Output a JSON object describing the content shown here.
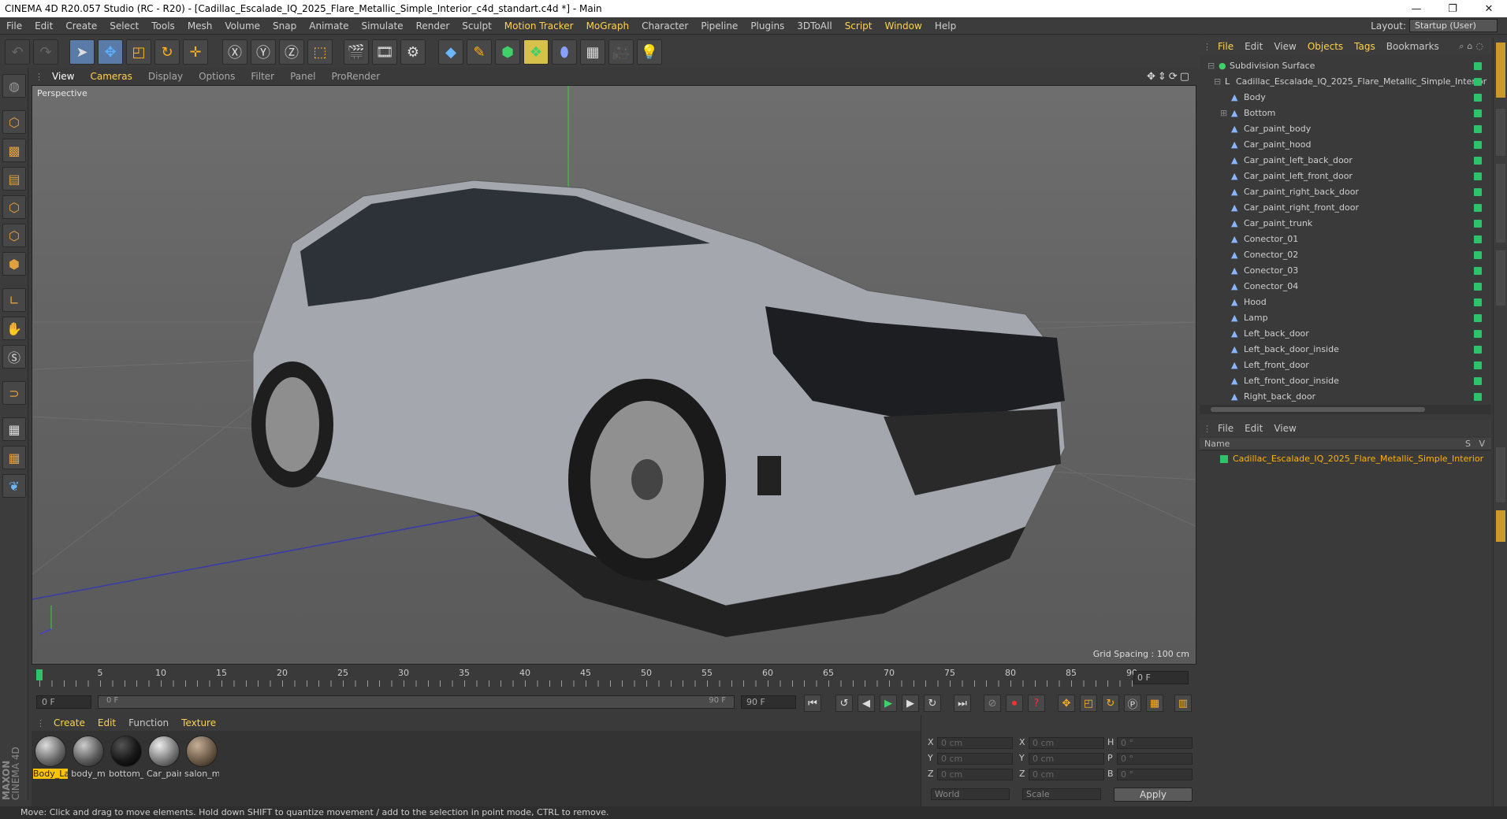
{
  "window": {
    "title": "CINEMA 4D R20.057 Studio (RC - R20) - [Cadillac_Escalade_IQ_2025_Flare_Metallic_Simple_Interior_c4d_standart.c4d *] - Main",
    "min": "—",
    "restore": "❐",
    "close": "✕"
  },
  "menu": [
    "File",
    "Edit",
    "Create",
    "Select",
    "Tools",
    "Mesh",
    "Volume",
    "Snap",
    "Animate",
    "Simulate",
    "Render",
    "Sculpt",
    "Motion Tracker",
    "MoGraph",
    "Character",
    "Pipeline",
    "Plugins",
    "3DToAll",
    "Script",
    "Window",
    "Help"
  ],
  "layout": {
    "label": "Layout:",
    "value": "Startup (User)"
  },
  "viewport": {
    "menu": [
      "View",
      "Cameras",
      "Display",
      "Options",
      "Filter",
      "Panel",
      "ProRender"
    ],
    "label": "Perspective",
    "grid_spacing": "Grid Spacing : 100 cm"
  },
  "timeline": {
    "ticks": [
      "0",
      "5",
      "10",
      "15",
      "20",
      "25",
      "30",
      "35",
      "40",
      "45",
      "50",
      "55",
      "60",
      "65",
      "70",
      "75",
      "80",
      "85",
      "90"
    ],
    "frame_end": "0 F"
  },
  "transport": {
    "start": "0 F",
    "range_start": "0 F",
    "range_end": "90 F",
    "end": "90 F"
  },
  "material_menu": [
    "Create",
    "Edit",
    "Function",
    "Texture"
  ],
  "materials": [
    {
      "name": "Body_La",
      "color": "#6a6a6a"
    },
    {
      "name": "body_m",
      "color": "#5c5c5c"
    },
    {
      "name": "bottom_",
      "color": "#161616"
    },
    {
      "name": "Car_pair",
      "color": "#7a7a7a"
    },
    {
      "name": "salon_m",
      "color": "#6b5a48"
    }
  ],
  "coords": {
    "rows": [
      {
        "a": "X",
        "av": "0 cm",
        "b": "X",
        "bv": "0 cm",
        "c": "H",
        "cv": "0 °"
      },
      {
        "a": "Y",
        "av": "0 cm",
        "b": "Y",
        "bv": "0 cm",
        "c": "P",
        "cv": "0 °"
      },
      {
        "a": "Z",
        "av": "0 cm",
        "b": "Z",
        "bv": "0 cm",
        "c": "B",
        "cv": "0 °"
      }
    ],
    "world": "World",
    "scale": "Scale",
    "apply": "Apply"
  },
  "status": "Move: Click and drag to move elements. Hold down SHIFT to quantize movement / add to the selection in point mode, CTRL to remove.",
  "object_menu": [
    "File",
    "Edit",
    "View",
    "Objects",
    "Tags",
    "Bookmarks"
  ],
  "objects": [
    "Subdivision Surface",
    "Cadillac_Escalade_IQ_2025_Flare_Metallic_Simple_Interior",
    "Body",
    "Bottom",
    "Car_paint_body",
    "Car_paint_hood",
    "Car_paint_left_back_door",
    "Car_paint_left_front_door",
    "Car_paint_right_back_door",
    "Car_paint_right_front_door",
    "Car_paint_trunk",
    "Conector_01",
    "Conector_02",
    "Conector_03",
    "Conector_04",
    "Hood",
    "Lamp",
    "Left_back_door",
    "Left_back_door_inside",
    "Left_front_door",
    "Left_front_door_inside",
    "Right_back_door"
  ],
  "layer_menu": [
    "File",
    "Edit",
    "View"
  ],
  "layers": {
    "header": "Name",
    "col_s": "S",
    "col_v": "V",
    "row": "Cadillac_Escalade_IQ_2025_Flare_Metallic_Simple_Interior"
  },
  "brand": {
    "maxon": "MAXON",
    "c4d": "CINEMA 4D"
  },
  "colors": {
    "accent": "#ffd24a",
    "green_dot": "#2ec26a",
    "selection": "#ffc300"
  }
}
